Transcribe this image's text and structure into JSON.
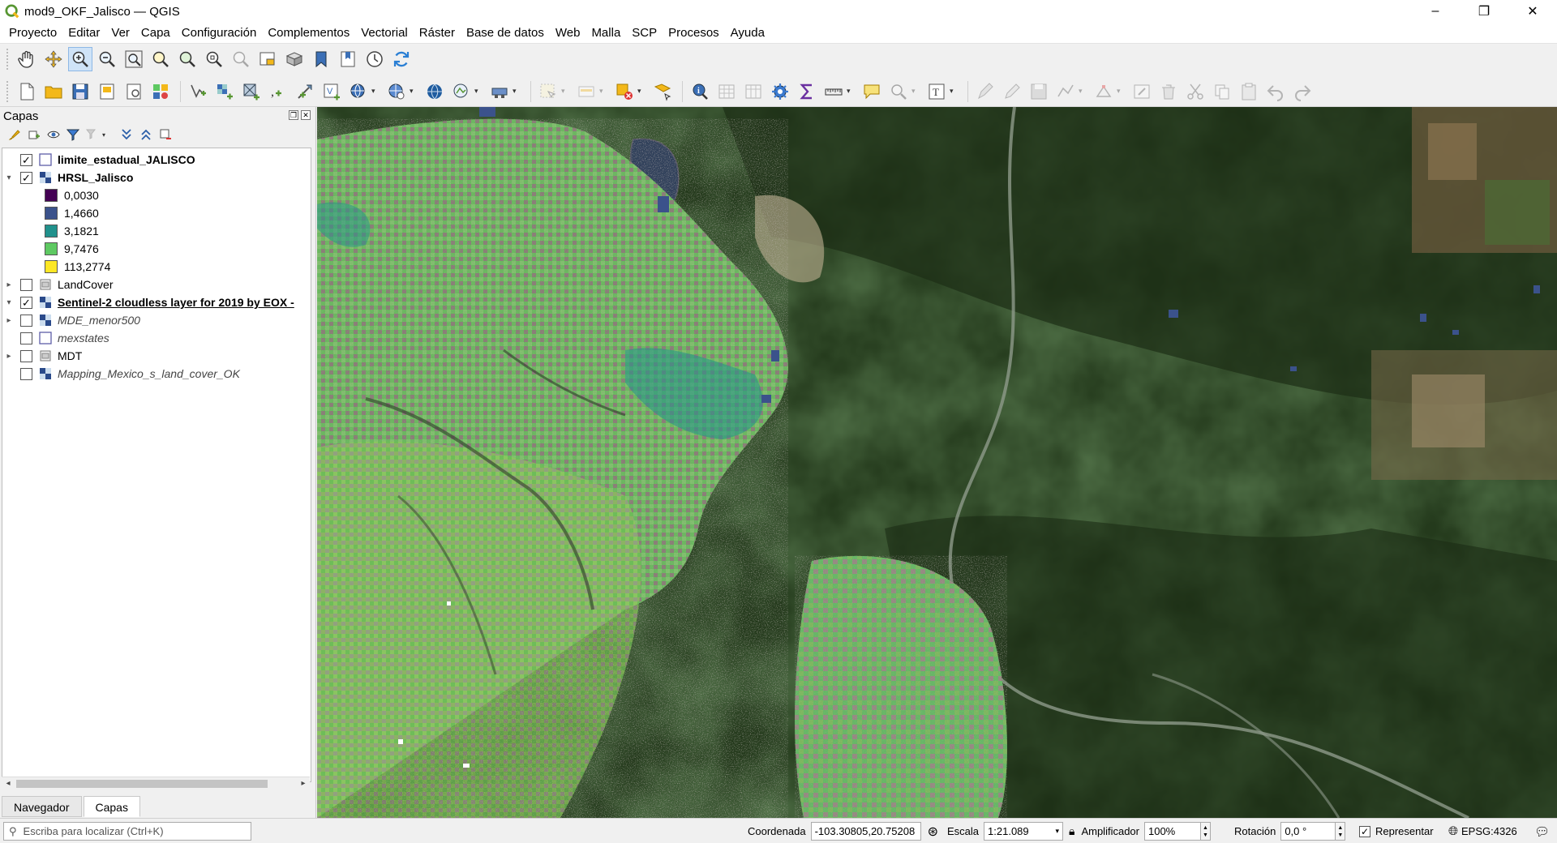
{
  "window": {
    "title": "mod9_OKF_Jalisco — QGIS",
    "minimize_glyph": "–",
    "maximize_glyph": "❐",
    "close_glyph": "✕"
  },
  "menu": [
    {
      "label": "Proyecto"
    },
    {
      "label": "Editar"
    },
    {
      "label": "Ver"
    },
    {
      "label": "Capa"
    },
    {
      "label": "Configuración"
    },
    {
      "label": "Complementos"
    },
    {
      "label": "Vectorial"
    },
    {
      "label": "Ráster"
    },
    {
      "label": "Base de datos"
    },
    {
      "label": "Web"
    },
    {
      "label": "Malla"
    },
    {
      "label": "SCP"
    },
    {
      "label": "Procesos"
    },
    {
      "label": "Ayuda"
    }
  ],
  "layers_panel": {
    "title": "Capas",
    "float_glyph": "❐",
    "close_glyph": "✕",
    "layers": [
      {
        "name": "limite_estadual_JALISCO",
        "checked": true,
        "expander": "",
        "style": "bold",
        "icon": "vector-polygon-icon"
      },
      {
        "name": "HRSL_Jalisco",
        "checked": true,
        "expander": "▾",
        "style": "bold",
        "icon": "raster-icon"
      },
      {
        "name": "LandCover",
        "checked": false,
        "expander": "▸",
        "style": "normal",
        "icon": "group-icon"
      },
      {
        "name": "Sentinel-2 cloudless layer for 2019 by EOX -",
        "checked": true,
        "expander": "▾",
        "style": "bold-underline",
        "icon": "raster-icon"
      },
      {
        "name": "MDE_menor500",
        "checked": false,
        "expander": "▸",
        "style": "italic",
        "icon": "raster-icon"
      },
      {
        "name": "mexstates",
        "checked": false,
        "expander": "",
        "style": "italic",
        "icon": "vector-polygon-icon"
      },
      {
        "name": "MDT",
        "checked": false,
        "expander": "▸",
        "style": "normal",
        "icon": "group-icon"
      },
      {
        "name": "Mapping_Mexico_s_land_cover_OK",
        "checked": false,
        "expander": "",
        "style": "italic",
        "icon": "raster-icon"
      }
    ],
    "legend": [
      {
        "label": "0,0030",
        "color": "#440154"
      },
      {
        "label": "1,4660",
        "color": "#3b528b"
      },
      {
        "label": "3,1821",
        "color": "#21918c"
      },
      {
        "label": "9,7476",
        "color": "#5ec962"
      },
      {
        "label": "113,2774",
        "color": "#fde725"
      }
    ],
    "tabs": [
      {
        "label": "Navegador",
        "active": false
      },
      {
        "label": "Capas",
        "active": true
      }
    ]
  },
  "statusbar": {
    "locator_placeholder": "Escriba para localizar (Ctrl+K)",
    "coordinate_label": "Coordenada",
    "coordinate_value": "-103.30805,20.75208",
    "scale_label": "Escala",
    "scale_value": "1:21.089",
    "magnifier_label": "Amplificador",
    "magnifier_value": "100%",
    "rotation_label": "Rotación",
    "rotation_value": "0,0 °",
    "render_label": "Representar",
    "render_checked": true,
    "crs_label": "EPSG:4326"
  },
  "colors": {
    "accent": "#589632",
    "qgis_yellow": "#f3b81a",
    "hrsl_green": "#5ec962",
    "hrsl_teal": "#21918c",
    "hrsl_blue": "#3b528b"
  }
}
